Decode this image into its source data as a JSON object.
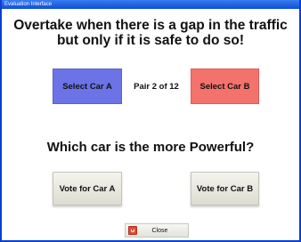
{
  "window": {
    "title": "Evaluation Interface"
  },
  "instruction": {
    "line1": "Overtake when there is a gap in the traffic",
    "line2": "but only if it is safe to do so!"
  },
  "selection": {
    "select_a_label": "Select Car A",
    "pair_label": "Pair 2 of 12",
    "select_b_label": "Select Car B",
    "select_a_color": "#6b73e6",
    "select_b_color": "#f4726c"
  },
  "question": {
    "text": "Which car is the more Powerful?"
  },
  "vote": {
    "vote_a_label": "Vote for Car A",
    "vote_b_label": "Vote for Car B"
  },
  "close": {
    "label": "Close",
    "icon": "close-icon"
  }
}
